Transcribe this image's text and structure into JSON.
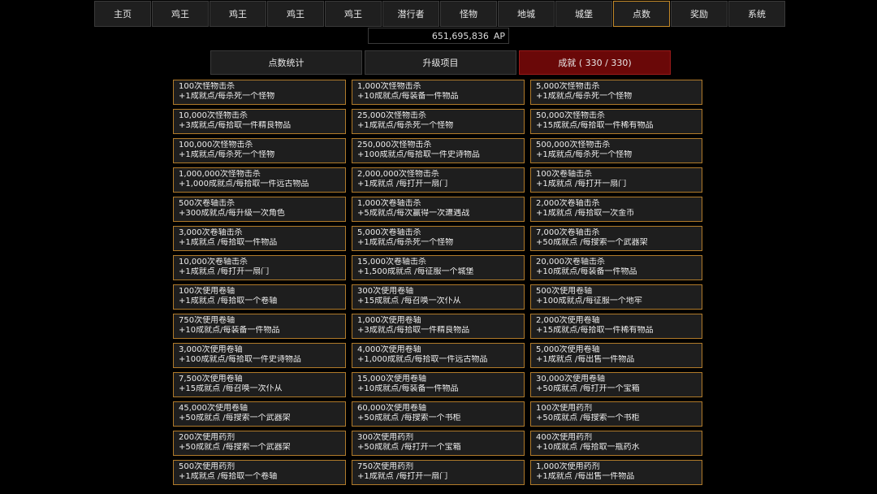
{
  "nav": [
    "主页",
    "鸡王",
    "鸡王",
    "鸡王",
    "鸡王",
    "潜行者",
    "怪物",
    "地城",
    "城堡",
    "点数",
    "奖励",
    "系统"
  ],
  "nav_active": 9,
  "ap": {
    "value": "651,695,836",
    "unit": "AP"
  },
  "subtabs": [
    "点数统计",
    "升级项目",
    "成就 ( 330 / 330)"
  ],
  "subtab_active": 2,
  "achievements": [
    {
      "title": "100次怪物击杀",
      "reward": "+1成就点/每杀死一个怪物"
    },
    {
      "title": "1,000次怪物击杀",
      "reward": "+10成就点/每装备一件物品"
    },
    {
      "title": "5,000次怪物击杀",
      "reward": "+1成就点/每杀死一个怪物"
    },
    {
      "title": "10,000次怪物击杀",
      "reward": "+3成就点/每拾取一件精良物品"
    },
    {
      "title": "25,000次怪物击杀",
      "reward": "+1成就点/每杀死一个怪物"
    },
    {
      "title": "50,000次怪物击杀",
      "reward": "+15成就点/每拾取一件稀有物品"
    },
    {
      "title": "100,000次怪物击杀",
      "reward": "+1成就点/每杀死一个怪物"
    },
    {
      "title": "250,000次怪物击杀",
      "reward": "+100成就点/每拾取一件史诗物品"
    },
    {
      "title": "500,000次怪物击杀",
      "reward": "+1成就点/每杀死一个怪物"
    },
    {
      "title": "1,000,000次怪物击杀",
      "reward": "+1,000成就点/每拾取一件远古物品"
    },
    {
      "title": "2,000,000次怪物击杀",
      "reward": "+1成就点 /每打开一扇门"
    },
    {
      "title": "100次卷轴击杀",
      "reward": "+1成就点 /每打开一扇门"
    },
    {
      "title": "500次卷轴击杀",
      "reward": "+300成就点/每升级一次角色"
    },
    {
      "title": "1,000次卷轴击杀",
      "reward": "+5成就点/每次赢得一次遭遇战"
    },
    {
      "title": "2,000次卷轴击杀",
      "reward": "+1成就点 /每拾取一次金币"
    },
    {
      "title": "3,000次卷轴击杀",
      "reward": "+1成就点 /每拾取一件物品"
    },
    {
      "title": "5,000次卷轴击杀",
      "reward": "+1成就点/每杀死一个怪物"
    },
    {
      "title": "7,000次卷轴击杀",
      "reward": "+50成就点 /每搜索一个武器架"
    },
    {
      "title": "10,000次卷轴击杀",
      "reward": "+1成就点 /每打开一扇门"
    },
    {
      "title": "15,000次卷轴击杀",
      "reward": "+1,500成就点 /每征服一个城堡"
    },
    {
      "title": "20,000次卷轴击杀",
      "reward": "+10成就点/每装备一件物品"
    },
    {
      "title": "100次使用卷轴",
      "reward": "+1成就点 /每拾取一个卷轴"
    },
    {
      "title": "300次使用卷轴",
      "reward": "+15成就点 /每召唤一次仆从"
    },
    {
      "title": "500次使用卷轴",
      "reward": "+100成就点/每征服一个地牢"
    },
    {
      "title": "750次使用卷轴",
      "reward": "+10成就点/每装备一件物品"
    },
    {
      "title": "1,000次使用卷轴",
      "reward": "+3成就点/每拾取一件精良物品"
    },
    {
      "title": "2,000次使用卷轴",
      "reward": "+15成就点/每拾取一件稀有物品"
    },
    {
      "title": "3,000次使用卷轴",
      "reward": "+100成就点/每拾取一件史诗物品"
    },
    {
      "title": "4,000次使用卷轴",
      "reward": "+1,000成就点/每拾取一件远古物品"
    },
    {
      "title": "5,000次使用卷轴",
      "reward": "+1成就点 /每出售一件物品"
    },
    {
      "title": "7,500次使用卷轴",
      "reward": "+15成就点 /每召唤一次仆从"
    },
    {
      "title": "15,000次使用卷轴",
      "reward": "+10成就点/每装备一件物品"
    },
    {
      "title": "30,000次使用卷轴",
      "reward": "+50成就点 /每打开一个宝箱"
    },
    {
      "title": "45,000次使用卷轴",
      "reward": "+50成就点 /每搜索一个武器架"
    },
    {
      "title": "60,000次使用卷轴",
      "reward": "+50成就点 /每搜索一个书柜"
    },
    {
      "title": "100次使用药剂",
      "reward": "+50成就点 /每搜索一个书柜"
    },
    {
      "title": "200次使用药剂",
      "reward": "+50成就点 /每搜索一个武器架"
    },
    {
      "title": "300次使用药剂",
      "reward": "+50成就点 /每打开一个宝箱"
    },
    {
      "title": "400次使用药剂",
      "reward": "+10成就点 /每拾取一瓶药水"
    },
    {
      "title": "500次使用药剂",
      "reward": "+1成就点 /每拾取一个卷轴"
    },
    {
      "title": "750次使用药剂",
      "reward": "+1成就点 /每打开一扇门"
    },
    {
      "title": "1,000次使用药剂",
      "reward": "+1成就点 /每出售一件物品"
    }
  ]
}
